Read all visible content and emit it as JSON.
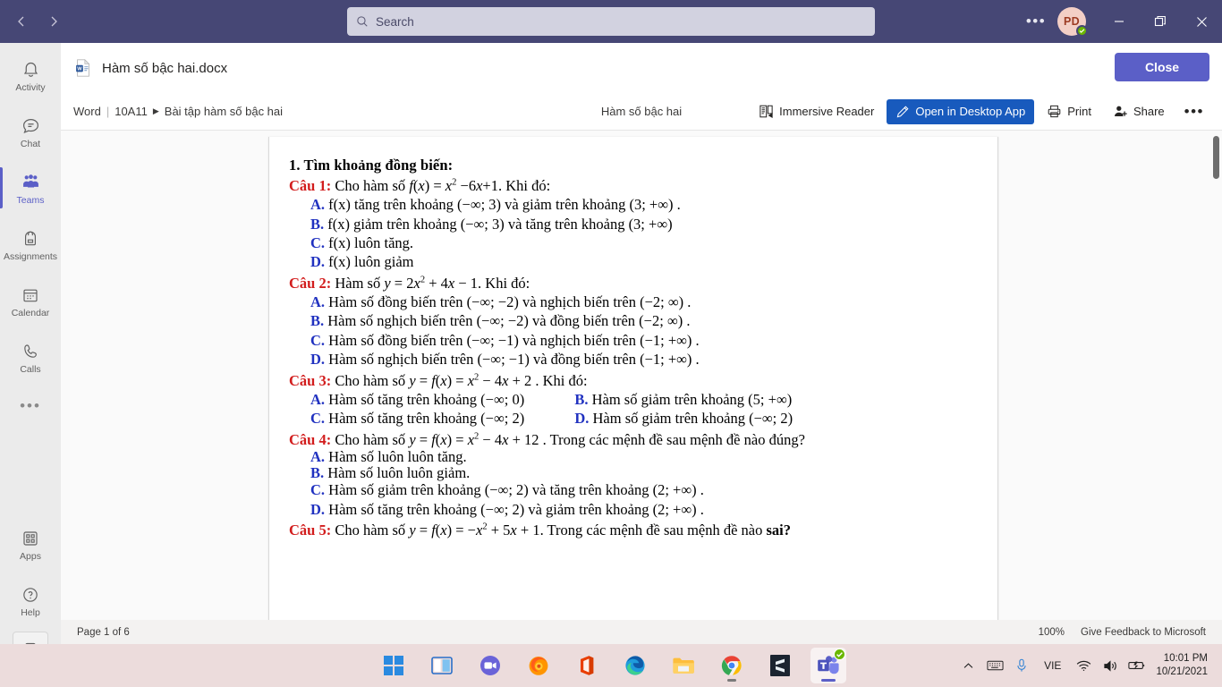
{
  "titlebar": {
    "back_icon": "chevron-left-icon",
    "forward_icon": "chevron-right-icon",
    "search_placeholder": "Search",
    "search_icon": "search-icon",
    "more_label": "•••",
    "avatar_initials": "PD",
    "presence": "available",
    "minimize_label": "minimize",
    "maximize_label": "restore",
    "close_label": "close",
    "bg": "#464775"
  },
  "rail": {
    "items": [
      {
        "label": "Activity",
        "icon": "bell-icon",
        "active": false
      },
      {
        "label": "Chat",
        "icon": "chat-icon",
        "active": false
      },
      {
        "label": "Teams",
        "icon": "teams-icon",
        "active": true
      },
      {
        "label": "Assignments",
        "icon": "backpack-icon",
        "active": false
      },
      {
        "label": "Calendar",
        "icon": "calendar-icon",
        "active": false
      },
      {
        "label": "Calls",
        "icon": "phone-icon",
        "active": false
      }
    ],
    "more_label": "•••",
    "bottom": [
      {
        "label": "Apps",
        "icon": "apps-grid-icon"
      },
      {
        "label": "Help",
        "icon": "question-circle-icon"
      }
    ],
    "device_icon": "mobile-device-icon",
    "accent": "#5b5fc7"
  },
  "doc_header": {
    "file_icon": "word-document-icon",
    "title": "Hàm số bậc hai.docx",
    "close_label": "Close",
    "close_color": "#5b5fc7"
  },
  "toolbar": {
    "breadcrumb": {
      "app": "Word",
      "separator": "|",
      "team": "10A11",
      "caret": "▶",
      "channel": "Bài tập hàm số bậc hai"
    },
    "center_title": "Hàm số bậc hai",
    "immersive_reader": {
      "label": "Immersive Reader",
      "icon": "immersive-reader-icon"
    },
    "open_desktop": {
      "label": "Open in Desktop App",
      "icon": "pencil-icon",
      "color": "#185abd"
    },
    "print": {
      "label": "Print",
      "icon": "printer-icon"
    },
    "share": {
      "label": "Share",
      "icon": "share-person-icon"
    },
    "overflow_label": "•••"
  },
  "document": {
    "section_title": "1. Tìm khoảng đồng biến:",
    "questions": [
      {
        "label": "Câu 1:",
        "stem_pre": "Cho hàm số ",
        "formula": "f(x) = x² − 6x + 1",
        "stem_post": ". Khi đó:",
        "layout": "single",
        "options": [
          {
            "letter": "A.",
            "text": "f(x)  tăng trên khoảng (−∞; 3)  và giảm trên khoảng (3; +∞) ."
          },
          {
            "letter": "B.",
            "text": "f(x)  giảm trên khoảng (−∞; 3) và tăng trên khoảng (3; +∞)"
          },
          {
            "letter": "C.",
            "text": "f(x)  luôn tăng."
          },
          {
            "letter": "D.",
            "text": "f(x)  luôn giảm"
          }
        ]
      },
      {
        "label": "Câu 2:",
        "stem_pre": "Hàm số ",
        "formula": "y = 2x² + 4x − 1",
        "stem_post": ". Khi đó:",
        "layout": "single",
        "options": [
          {
            "letter": "A.",
            "text": "Hàm số đồng biến trên (−∞; −2) và nghịch biến trên (−2; ∞) ."
          },
          {
            "letter": "B.",
            "text": "Hàm số nghịch biến trên (−∞; −2) và đồng biến trên (−2; ∞) ."
          },
          {
            "letter": "C.",
            "text": "Hàm số đồng biến trên (−∞; −1) và nghịch biến trên (−1; +∞) ."
          },
          {
            "letter": "D.",
            "text": "Hàm số nghịch biến trên (−∞; −1) và đồng biến trên (−1; +∞) ."
          }
        ]
      },
      {
        "label": "Câu 3:",
        "stem_pre": "Cho hàm số ",
        "formula": "y = f(x) = x² − 4x + 2",
        "stem_post": " . Khi đó:",
        "layout": "two-column",
        "options": [
          {
            "letter": "A.",
            "text": "Hàm số tăng trên khoảng (−∞; 0)"
          },
          {
            "letter": "B.",
            "text": "Hàm số giảm trên khoảng (5; +∞)"
          },
          {
            "letter": "C.",
            "text": "Hàm số tăng trên khoảng (−∞; 2)"
          },
          {
            "letter": "D.",
            "text": "Hàm số giảm trên khoảng (−∞; 2)"
          }
        ]
      },
      {
        "label": "Câu 4:",
        "stem_pre": "Cho hàm số ",
        "formula": "y = f(x) = x² − 4x + 12",
        "stem_post": " . Trong các mệnh đề sau mệnh đề nào đúng?",
        "layout": "single",
        "options": [
          {
            "letter": "A.",
            "text": "Hàm số luôn luôn tăng.",
            "tight": true
          },
          {
            "letter": "B.",
            "text": "Hàm số luôn luôn giảm.",
            "tight": true
          },
          {
            "letter": "C.",
            "text": "Hàm số giảm trên khoảng (−∞; 2)  và tăng trên khoảng (2; +∞) ."
          },
          {
            "letter": "D.",
            "text": "Hàm số tăng trên khoảng (−∞; 2) và giảm trên khoảng (2; +∞) ."
          }
        ]
      },
      {
        "label": "Câu 5:",
        "stem_pre": "Cho hàm số ",
        "formula": "y = f(x) = −x² + 5x + 1",
        "stem_post": ". Trong các mệnh đề sau mệnh đề nào ",
        "stem_bold": "sai?",
        "layout": "single",
        "options": []
      }
    ],
    "label_color": "#d21d1d",
    "option_letter_color": "#2031c0"
  },
  "statusbar": {
    "page_info": "Page 1 of 6",
    "zoom": "100%",
    "feedback": "Give Feedback to Microsoft"
  },
  "taskbar": {
    "apps": [
      {
        "name": "start-windows-icon"
      },
      {
        "name": "task-view-icon"
      },
      {
        "name": "zoom-meetings-icon"
      },
      {
        "name": "firefox-icon"
      },
      {
        "name": "office-icon"
      },
      {
        "name": "microsoft-edge-icon"
      },
      {
        "name": "file-explorer-icon"
      },
      {
        "name": "google-chrome-icon"
      },
      {
        "name": "sublime-text-icon"
      },
      {
        "name": "microsoft-teams-icon"
      }
    ],
    "tray": {
      "chevron_up": "show-hidden-icons",
      "keyboard": "touch-keyboard-icon",
      "mic": "microphone-icon",
      "language": "VIE",
      "wifi": "wifi-icon",
      "volume": "speaker-icon",
      "battery": "battery-charging-icon",
      "time": "10:01 PM",
      "date": "10/21/2021"
    },
    "bg": "#ecdcdc"
  }
}
